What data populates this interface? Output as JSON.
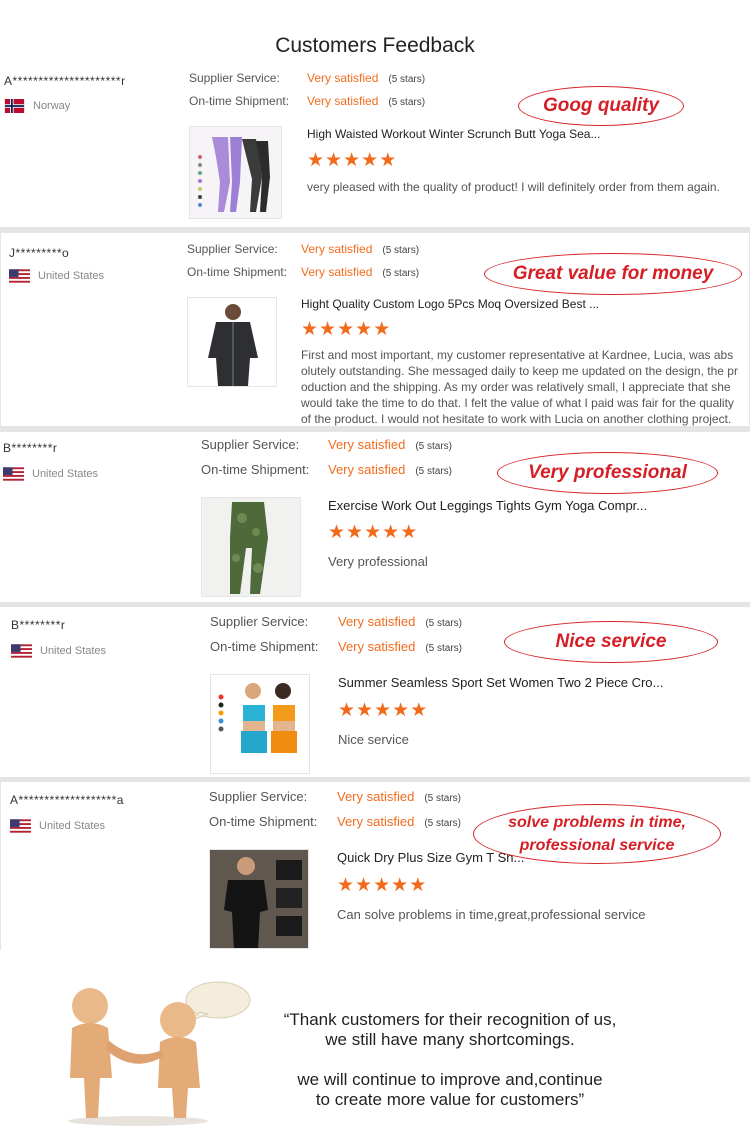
{
  "page_title": "Customers Feedback",
  "labels": {
    "supplier": "Supplier Service:",
    "shipment": "On-time Shipment:"
  },
  "colors": {
    "accent": "#f26b1d",
    "callout": "#d51f26"
  },
  "reviews": [
    {
      "user": "A*********************r",
      "country": "Norway",
      "flag": "norway-flag-icon",
      "supplier_value": "Very satisfied",
      "supplier_stars": "(5 stars)",
      "shipment_value": "Very satisfied",
      "shipment_stars": "(5 stars)",
      "product": "High Waisted Workout Winter Scrunch Butt Yoga Sea...",
      "rating": 5,
      "comment": "very pleased with the quality of product! I will definitely order from them again.",
      "callout": "Goog quality"
    },
    {
      "user": "J*********o",
      "country": "United States",
      "flag": "us-flag-icon",
      "supplier_value": "Very satisfied",
      "supplier_stars": "(5 stars)",
      "shipment_value": "Very satisfied",
      "shipment_stars": "(5 stars)",
      "product": "Hight Quality Custom Logo 5Pcs Moq Oversized Best ...",
      "rating": 5,
      "comment": "First and most important, my customer representative at Kardnee, Lucia, was abs olutely outstanding. She messaged daily to keep me updated on the design, the pr oduction and the shipping. As my order was relatively small, I appreciate that she would take the time to do that. I felt the value of what I paid was fair for the quality of the product. I would not hesitate to work with Lucia on another clothing project.",
      "callout": "Great value for money"
    },
    {
      "user": "B********r",
      "country": "United States",
      "flag": "us-flag-icon",
      "supplier_value": "Very satisfied",
      "supplier_stars": "(5 stars)",
      "shipment_value": "Very satisfied",
      "shipment_stars": "(5 stars)",
      "product": "Exercise Work Out Leggings Tights Gym Yoga Compr...",
      "rating": 5,
      "comment": "Very professional",
      "callout": "Very professional"
    },
    {
      "user": "B********r",
      "country": "United States",
      "flag": "us-flag-icon",
      "supplier_value": "Very satisfied",
      "supplier_stars": "(5 stars)",
      "shipment_value": "Very satisfied",
      "shipment_stars": "(5 stars)",
      "product": "Summer Seamless Sport Set Women Two 2 Piece Cro...",
      "rating": 5,
      "comment": "Nice service",
      "callout": "Nice service"
    },
    {
      "user": "A*******************a",
      "country": "United States",
      "flag": "us-flag-icon",
      "supplier_value": "Very satisfied",
      "supplier_stars": "(5 stars)",
      "shipment_value": "Very satisfied",
      "shipment_stars": "(5 stars)",
      "product": "Quick Dry Plus Size Gym T Sh...",
      "rating": 5,
      "comment": "Can solve problems in time,great,professional service",
      "callout_line1": "solve problems in time,",
      "callout_line2": "professional service"
    }
  ],
  "footer": {
    "line1": "“Thank customers for their recognition of us,",
    "line2": "we still have many shortcomings.",
    "line3": "we will continue to improve and,continue",
    "line4": "to create more value for customers”"
  }
}
